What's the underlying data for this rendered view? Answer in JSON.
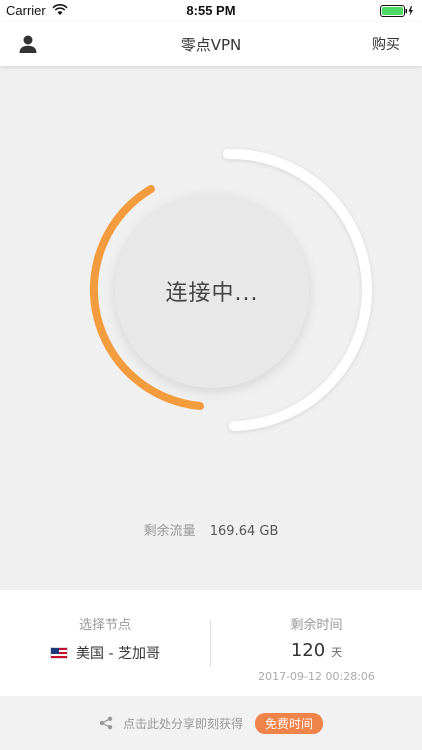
{
  "status_bar": {
    "carrier": "Carrier",
    "time": "8:55 PM",
    "battery_color": "#4cd964"
  },
  "nav": {
    "user_icon": "person-icon",
    "title": "零点VPN",
    "buy_label": "购买"
  },
  "connection": {
    "status_text": "连接中...",
    "progress_color": "#f39c3e",
    "track_color": "#ffffff"
  },
  "traffic": {
    "label": "剩余流量",
    "value": "169.64 GB"
  },
  "node": {
    "label": "选择节点",
    "flag_icon": "us-flag-icon",
    "value": "美国 - 芝加哥"
  },
  "remaining_time": {
    "label": "剩余时间",
    "days": "120",
    "unit": "天",
    "expire": "2017-09-12 00:28:06"
  },
  "share": {
    "icon": "share-icon",
    "text": "点击此处分享即刻获得",
    "button_label": "免费时间",
    "button_color": "#f0834a"
  }
}
